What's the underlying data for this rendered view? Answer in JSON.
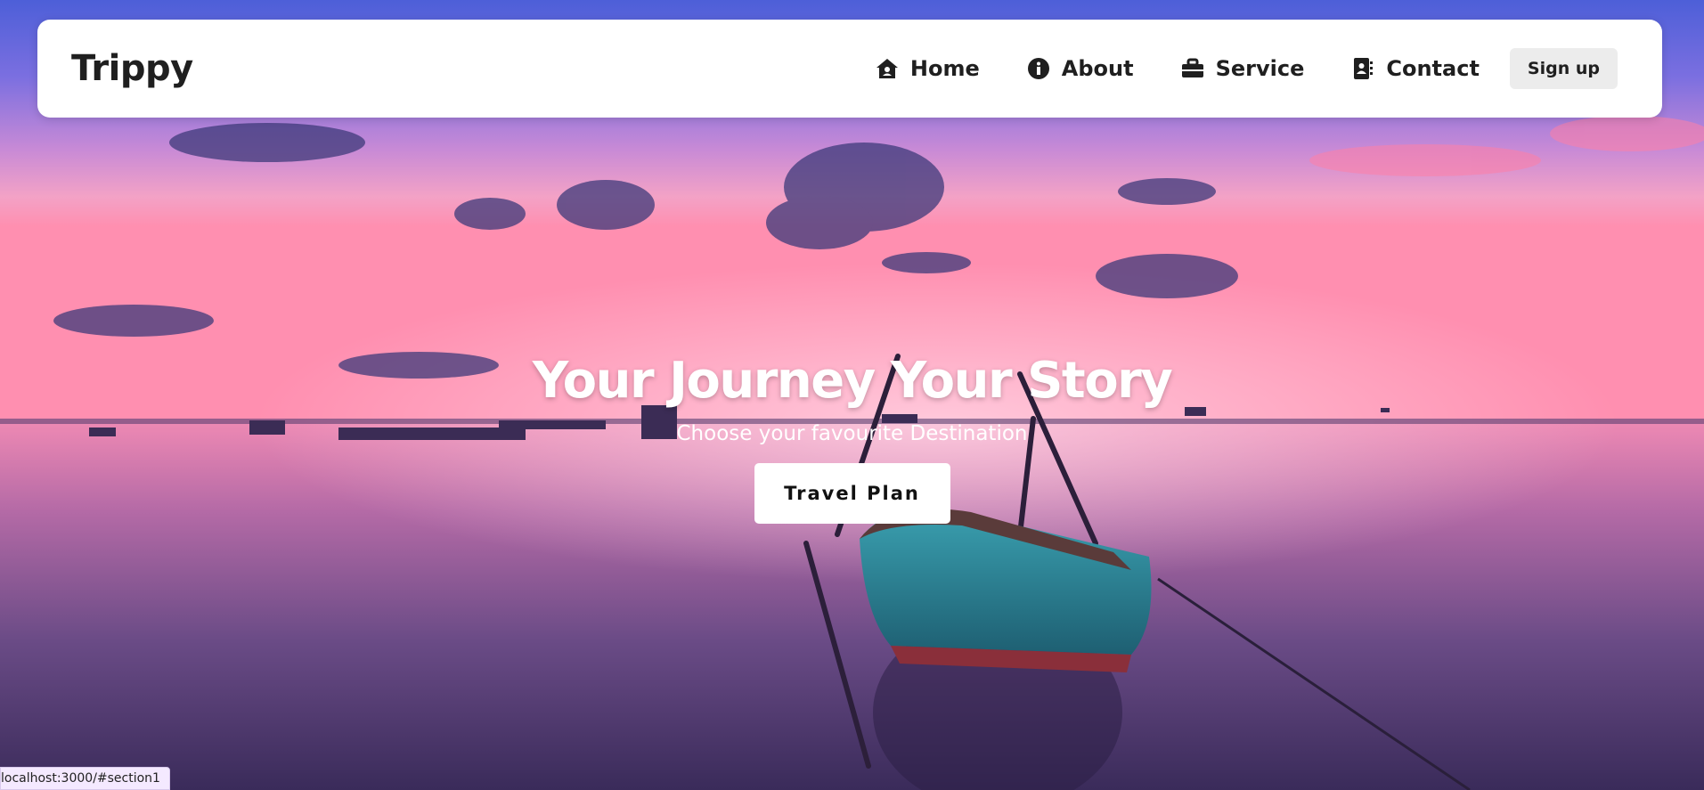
{
  "brand": {
    "logo": "Trippy"
  },
  "nav": {
    "items": [
      {
        "label": "Home",
        "icon": "home-icon"
      },
      {
        "label": "About",
        "icon": "info-icon"
      },
      {
        "label": "Service",
        "icon": "briefcase-icon"
      },
      {
        "label": "Contact",
        "icon": "contact-book-icon"
      }
    ],
    "signup_label": "Sign up"
  },
  "hero": {
    "title": "Your Journey Your Story",
    "subtitle": "Choose your favourite Destination",
    "cta_label": "Travel Plan",
    "background": "sunset-lake-boat-photo"
  },
  "status_bar": {
    "url": "localhost:3000/#section1"
  },
  "colors": {
    "nav_bg": "#ffffff",
    "text_dark": "#1f1f1f",
    "signup_bg": "#ececec",
    "hero_text": "#ffffff"
  }
}
